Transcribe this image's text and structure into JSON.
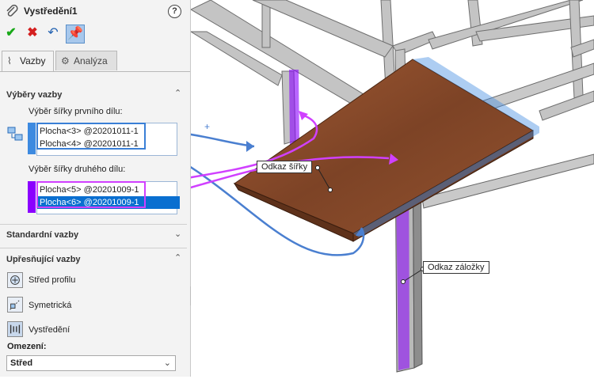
{
  "panel": {
    "title": "Vystředění1",
    "help": "?",
    "tabs": [
      {
        "label": "Vazby",
        "icon": "paperclip-icon",
        "active": true
      },
      {
        "label": "Analýza",
        "icon": "gear-icon",
        "active": false
      }
    ],
    "sections": {
      "mate_selections": {
        "title": "Výběry vazby",
        "first_label": "Výběr šířky prvního dílu:",
        "first_items": [
          "Plocha<3> @20201011-1",
          "Plocha<4> @20201011-1"
        ],
        "second_label": "Výběr šířky druhého dílu:",
        "second_items": [
          "Plocha<5> @20201009-1",
          "Plocha<6> @20201009-1"
        ]
      },
      "standard": {
        "title": "Standardní vazby"
      },
      "refining": {
        "title": "Upřesňující vazby",
        "options": [
          "Střed profilu",
          "Symetrická",
          "Vystředění"
        ],
        "constraint_label": "Omezení:",
        "constraint_value": "Střed"
      }
    }
  },
  "viewport": {
    "callouts": {
      "width_ref": "Odkaz šířky",
      "tab_ref": "Odkaz záložky"
    }
  },
  "colors": {
    "first_selection": "#3d8ae0",
    "second_selection": "#8b00ff",
    "arrow_blue": "#4a7fd0",
    "arrow_magenta": "#d040ff",
    "wood": "#8a4b2a",
    "frame": "#b9b9b9"
  }
}
